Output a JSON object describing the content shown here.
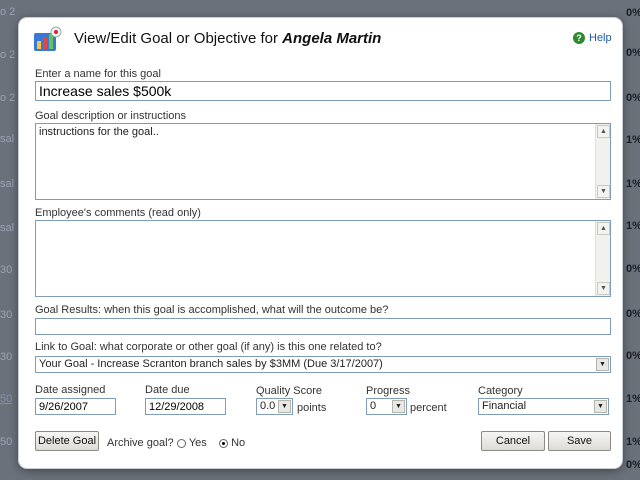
{
  "background": {
    "left_fragments": [
      {
        "text": "o 2",
        "link": false
      },
      {
        "text": "o 2",
        "link": false
      },
      {
        "text": "o 2",
        "link": false
      },
      {
        "text": "sal",
        "link": false
      },
      {
        "text": "sal",
        "link": false
      },
      {
        "text": "sal",
        "link": false
      },
      {
        "text": "30",
        "link": false
      },
      {
        "text": "30",
        "link": false
      },
      {
        "text": "30",
        "link": false
      },
      {
        "text": "50",
        "link": true
      },
      {
        "text": "50",
        "link": false
      }
    ],
    "right_fragments": [
      "0%",
      "0%",
      "0%",
      "1%",
      "1%",
      "1%",
      "0%",
      "0%",
      "0%",
      "1%",
      "1%",
      "0%"
    ]
  },
  "dialog": {
    "title_prefix": "View/Edit Goal or Objective for",
    "title_name": "Angela Martin",
    "help_label": "Help",
    "icons": {
      "app": "goal-chart-icon",
      "help": "help-icon"
    },
    "name_label": "Enter a name for this goal",
    "name_value": "Increase sales $500k",
    "description_label": "Goal description or instructions",
    "description_value": "instructions for the goal..",
    "comments_label": "Employee's comments (read only)",
    "comments_value": "",
    "results_label": "Goal Results: when this goal is accomplished, what will the outcome be?",
    "results_value": "",
    "link_label": "Link to Goal: what corporate or other goal (if any) is this one related to?",
    "link_value": "Your Goal - Increase Scranton branch sales by $3MM (Due 3/17/2007)",
    "date_assigned_label": "Date assigned",
    "date_assigned_value": "9/26/2007",
    "date_due_label": "Date due",
    "date_due_value": "12/29/2008",
    "quality_label": "Quality Score",
    "quality_value": "0.0",
    "quality_unit": "points",
    "progress_label": "Progress",
    "progress_value": "0",
    "progress_unit": "percent",
    "category_label": "Category",
    "category_value": "Financial",
    "delete_label": "Delete Goal",
    "archive_label": "Archive goal?",
    "archive_yes": "Yes",
    "archive_no": "No",
    "archive_selected": "No",
    "cancel_label": "Cancel",
    "save_label": "Save"
  }
}
